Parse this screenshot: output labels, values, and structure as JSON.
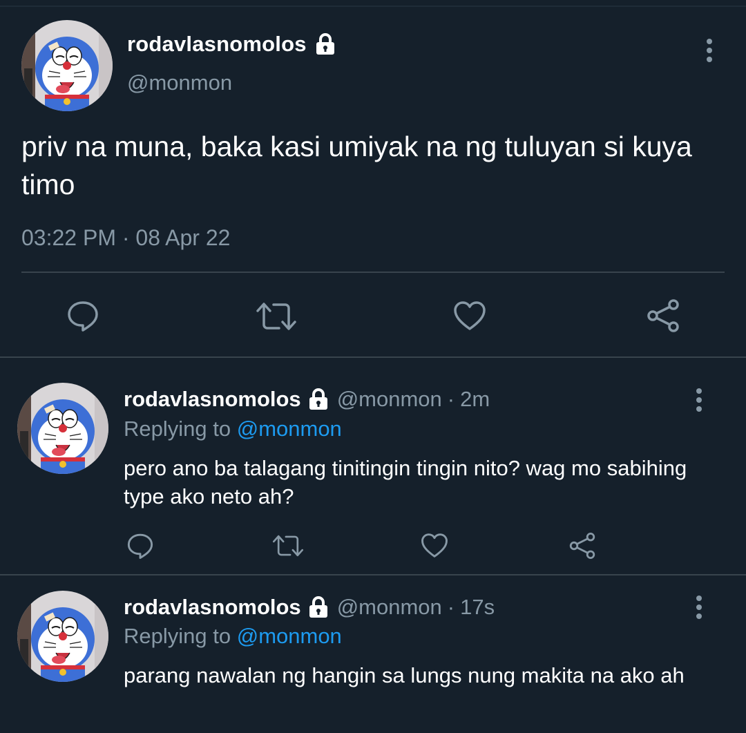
{
  "main_tweet": {
    "display_name": "rodavlasnomolos",
    "handle": "@monmon",
    "text": "priv na muna, baka kasi umiyak na ng tuluyan si kuya timo",
    "timestamp": "03:22 PM · 08 Apr 22",
    "avatar_icon": "doraemon-avatar",
    "protected_icon": "lock-icon",
    "actions": [
      "reply-icon",
      "retweet-icon",
      "like-icon",
      "share-icon"
    ]
  },
  "replies": [
    {
      "display_name": "rodavlasnomolos",
      "handle": "@monmon",
      "separator": "·",
      "time": "2m",
      "replying_label": "Replying to",
      "replying_to": "@monmon",
      "text": "pero ano ba talagang tinitingin tingin nito? wag mo sabihing type ako neto ah?"
    },
    {
      "display_name": "rodavlasnomolos",
      "handle": "@monmon",
      "separator": "·",
      "time": "17s",
      "replying_label": "Replying to",
      "replying_to": "@monmon",
      "text": "parang nawalan ng hangin sa lungs nung makita na ako ah"
    }
  ],
  "colors": {
    "background": "#15202b",
    "text": "#ffffff",
    "secondary": "#8899a6",
    "link": "#1d9bf0",
    "divider": "#38444d"
  }
}
